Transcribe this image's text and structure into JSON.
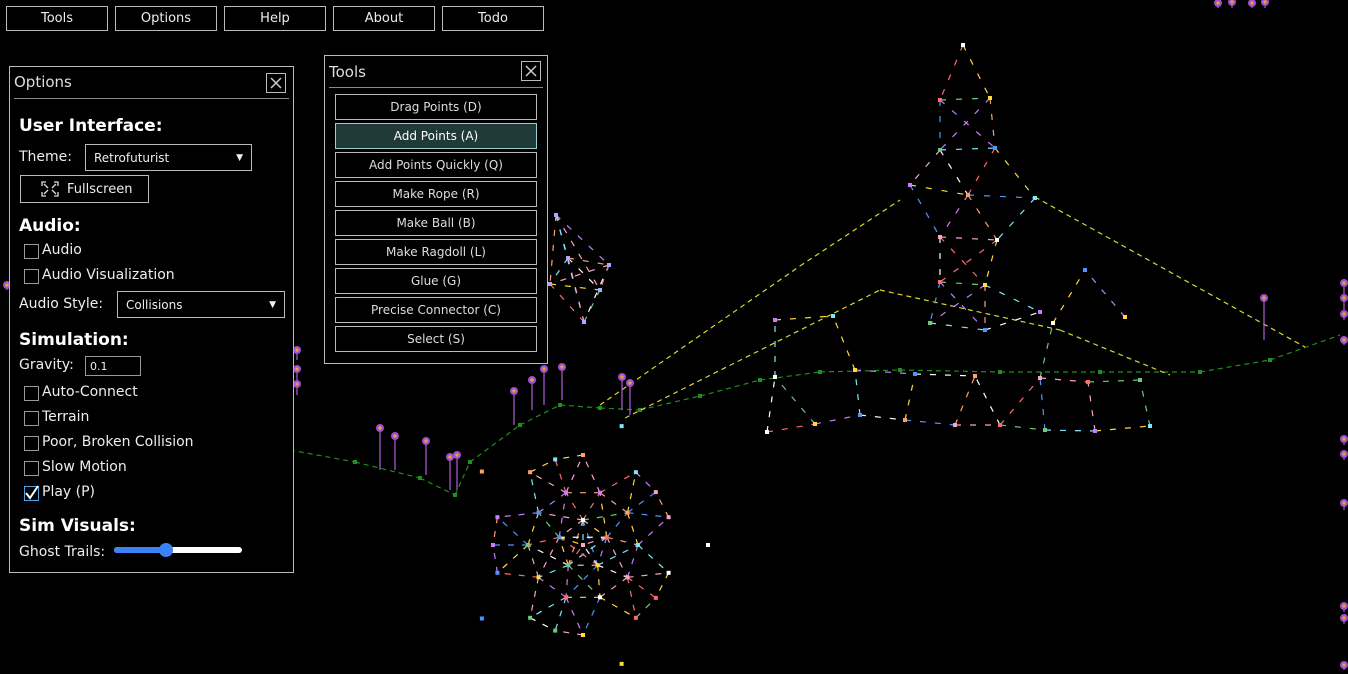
{
  "menubar": {
    "items": [
      "Tools",
      "Options",
      "Help",
      "About",
      "Todo"
    ]
  },
  "options_panel": {
    "title": "Options",
    "ui_heading": "User Interface:",
    "theme_label": "Theme:",
    "theme_value": "Retrofuturist",
    "fullscreen_label": "Fullscreen",
    "audio_heading": "Audio:",
    "audio_label": "Audio",
    "audio_checked": false,
    "audio_vis_label": "Audio Visualization",
    "audio_vis_checked": false,
    "audio_style_label": "Audio Style:",
    "audio_style_value": "Collisions",
    "sim_heading": "Simulation:",
    "gravity_label": "Gravity:",
    "gravity_value": "0.1",
    "auto_connect_label": "Auto-Connect",
    "auto_connect_checked": false,
    "terrain_label": "Terrain",
    "terrain_checked": false,
    "poor_collision_label": "Poor, Broken Collision",
    "poor_collision_checked": false,
    "slow_motion_label": "Slow Motion",
    "slow_motion_checked": false,
    "play_label": "Play (P)",
    "play_checked": true,
    "visuals_heading": "Sim Visuals:",
    "ghost_trails_label": "Ghost Trails:",
    "ghost_trails_value": 0.41
  },
  "tools_panel": {
    "title": "Tools",
    "active_tool": "Add Points (A)",
    "tools": [
      "Drag Points (D)",
      "Add Points (A)",
      "Add Points Quickly (Q)",
      "Make Rope (R)",
      "Make Ball (B)",
      "Make Ragdoll (L)",
      "Glue (G)",
      "Precise Connector (C)",
      "Select (S)"
    ]
  },
  "colors": {
    "background": "#000000",
    "border": "#bbbbbb",
    "active_tool_bg": "#1f3a38",
    "accent": "#3b82f6",
    "terrain_green": "#1f8f1f",
    "rope_yellow": "#d8d830",
    "flower_purple": "#9b4fd6",
    "flower_center": "#f0a020"
  }
}
